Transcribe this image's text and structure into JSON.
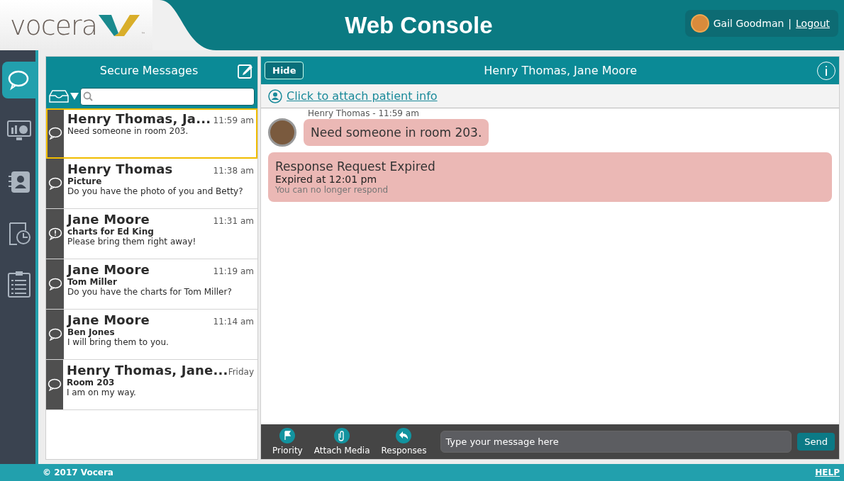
{
  "header": {
    "logo_text": "vocera",
    "logo_tm": "™",
    "title": "Web Console",
    "user": {
      "name": "Gail Goodman",
      "separator": "|",
      "logout": "Logout"
    }
  },
  "rail": [
    {
      "kind": "messages",
      "selected": true
    },
    {
      "kind": "dashboard",
      "selected": false
    },
    {
      "kind": "contacts",
      "selected": false
    },
    {
      "kind": "history",
      "selected": false
    },
    {
      "kind": "tasks",
      "selected": false
    }
  ],
  "messages_panel": {
    "title": "Secure Messages",
    "conversations": [
      {
        "kind": "chat",
        "selected": true,
        "name": "Henry Thomas, Ja...",
        "time": "11:59 am",
        "preview": "Need someone in room 203."
      },
      {
        "kind": "chat",
        "selected": false,
        "name": "Henry Thomas",
        "time": "11:38 am",
        "subject": "Picture",
        "preview": "Do you have the photo of you and Betty?"
      },
      {
        "kind": "alert",
        "selected": false,
        "name": "Jane Moore",
        "time": "11:31 am",
        "subject": "charts for Ed King",
        "preview": "Please bring them right away!"
      },
      {
        "kind": "chat",
        "selected": false,
        "name": "Jane Moore",
        "time": "11:19 am",
        "subject": "Tom Miller",
        "preview": "Do you have the charts for Tom Miller?"
      },
      {
        "kind": "chat",
        "selected": false,
        "name": "Jane Moore",
        "time": "11:14 am",
        "subject": "Ben Jones",
        "preview": "I will bring them to you."
      },
      {
        "kind": "chat",
        "selected": false,
        "name": "Henry Thomas, Jane...",
        "time": "Friday",
        "subject": "Room 203",
        "preview": "I am on my way."
      }
    ]
  },
  "chat": {
    "hide_button": "Hide",
    "title": "Henry Thomas, Jane Moore",
    "attach_link": "Click to attach patient info",
    "messages": [
      {
        "sender_line": "Henry Thomas - 11:59 am",
        "text": "Need someone in room 203."
      }
    ],
    "expired": {
      "title": "Response Request Expired",
      "time": "Expired at 12:01 pm",
      "note": "You can no longer respond"
    },
    "actions": [
      {
        "kind": "priority",
        "label": "Priority"
      },
      {
        "kind": "attach",
        "label": "Attach Media"
      },
      {
        "kind": "responses",
        "label": "Responses"
      }
    ],
    "input": {
      "placeholder": "Type your message here"
    },
    "send_button": "Send"
  },
  "footer": {
    "copyright": "© 2017 Vocera",
    "help": "HELP"
  }
}
